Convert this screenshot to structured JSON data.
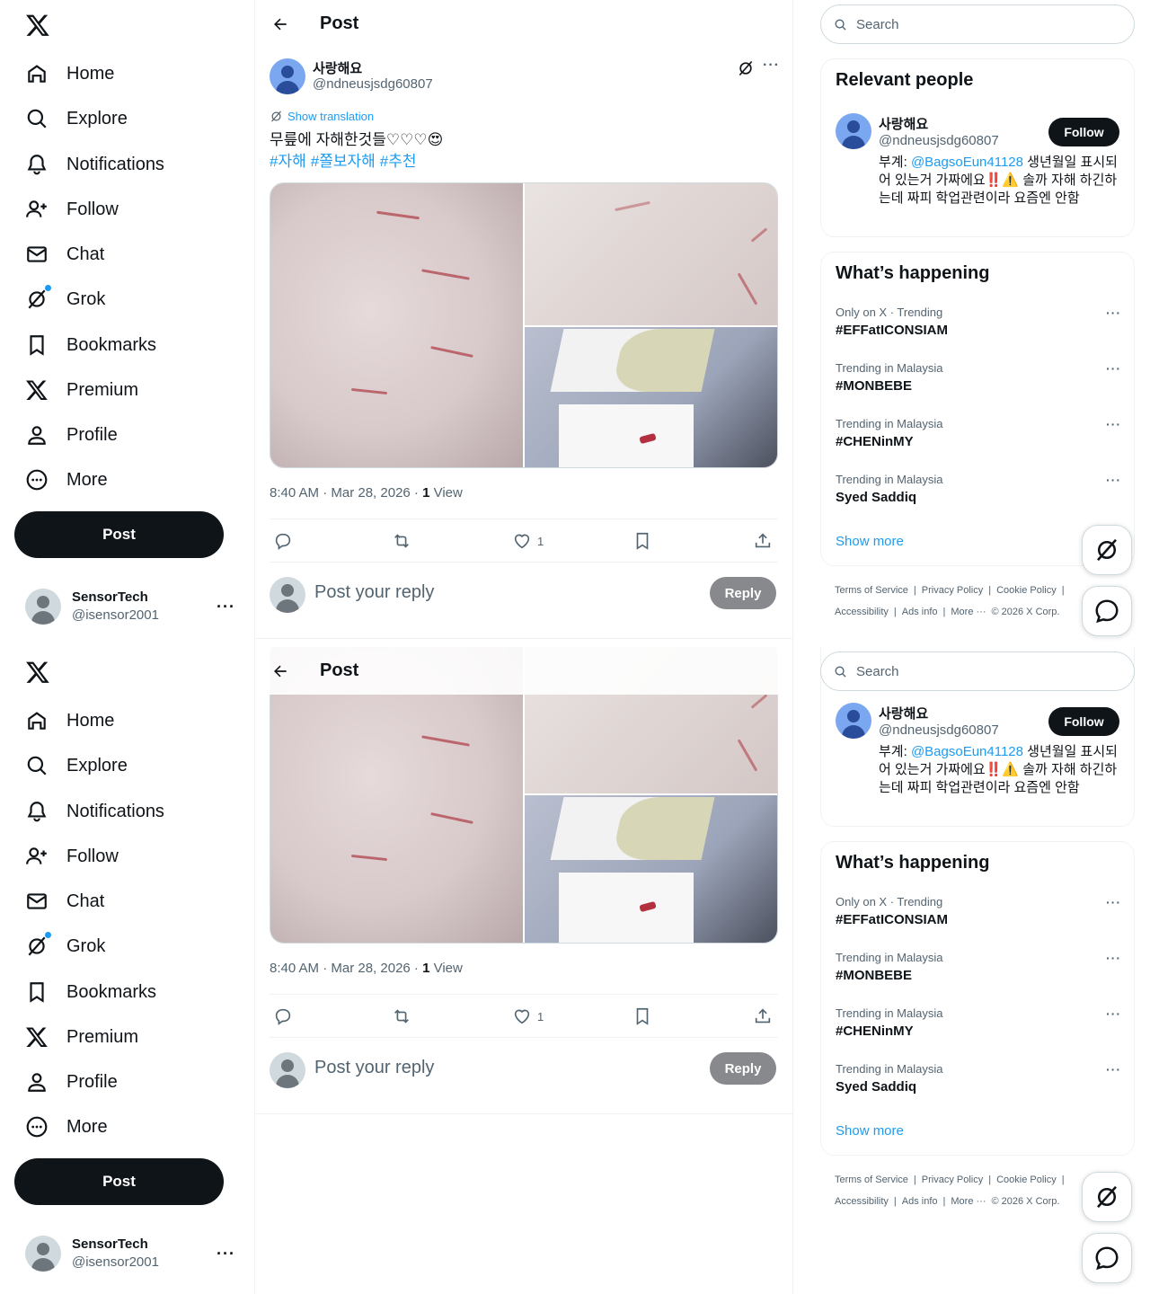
{
  "nav": {
    "items": [
      {
        "label": "Home",
        "icon": "home-icon"
      },
      {
        "label": "Explore",
        "icon": "search-icon"
      },
      {
        "label": "Notifications",
        "icon": "bell-icon"
      },
      {
        "label": "Follow",
        "icon": "follow-icon"
      },
      {
        "label": "Chat",
        "icon": "mail-icon"
      },
      {
        "label": "Grok",
        "icon": "grok-icon"
      },
      {
        "label": "Bookmarks",
        "icon": "bookmark-icon"
      },
      {
        "label": "Premium",
        "icon": "x-logo-icon"
      },
      {
        "label": "Profile",
        "icon": "person-icon"
      },
      {
        "label": "More",
        "icon": "more-circle-icon"
      }
    ],
    "post_button": "Post"
  },
  "account": {
    "name": "SensorTech",
    "handle": "@isensor2001",
    "more": "···"
  },
  "header": {
    "title": "Post"
  },
  "post": {
    "author_name": "사랑해요",
    "author_handle": "@ndneusjsdg60807",
    "more": "···",
    "translate": "Show translation",
    "text": "무릎에 자해한것들♡♡♡😍",
    "hashtags": [
      "#자해",
      "#쫄보자해",
      "#추천"
    ],
    "time": "8:40 AM · Mar 28, 2026 · ",
    "views_count": "1",
    "views_label": " View",
    "likes": "1"
  },
  "reply": {
    "placeholder": "Post your reply",
    "button": "Reply"
  },
  "search": {
    "placeholder": "Search"
  },
  "relevant": {
    "title": "Relevant people",
    "name": "사랑해요",
    "handle": "@ndneusjsdg60807",
    "follow": "Follow",
    "bio_prefix": "부계: ",
    "bio_mention": "@BagsoEun41128",
    "bio_rest": " 생년월일 표시되어 있는거 가짜에요‼️⚠️ 솔까 자해 하긴하는데 짜피 학업관련이라 요즘엔 안함"
  },
  "happening": {
    "title": "What’s happening",
    "trends": [
      {
        "meta": "Only on X · Trending",
        "name": "#EFFatICONSIAM"
      },
      {
        "meta": "Trending in Malaysia",
        "name": "#MONBEBE"
      },
      {
        "meta": "Trending in Malaysia",
        "name": "#CHENinMY"
      },
      {
        "meta": "Trending in Malaysia",
        "name": "Syed Saddiq"
      }
    ],
    "more": "···",
    "show_more": "Show more"
  },
  "footer": {
    "links": [
      "Terms of Service",
      "|",
      "Privacy Policy",
      "|",
      "Cookie Policy",
      "|"
    ],
    "links2": [
      "Accessibility",
      "|",
      "Ads info",
      "|",
      "More ···",
      "© 2026 X Corp."
    ]
  },
  "colors": {
    "accent": "#1d9bf0",
    "text": "#0f1419",
    "muted": "#536471",
    "button": "#0f1419"
  }
}
